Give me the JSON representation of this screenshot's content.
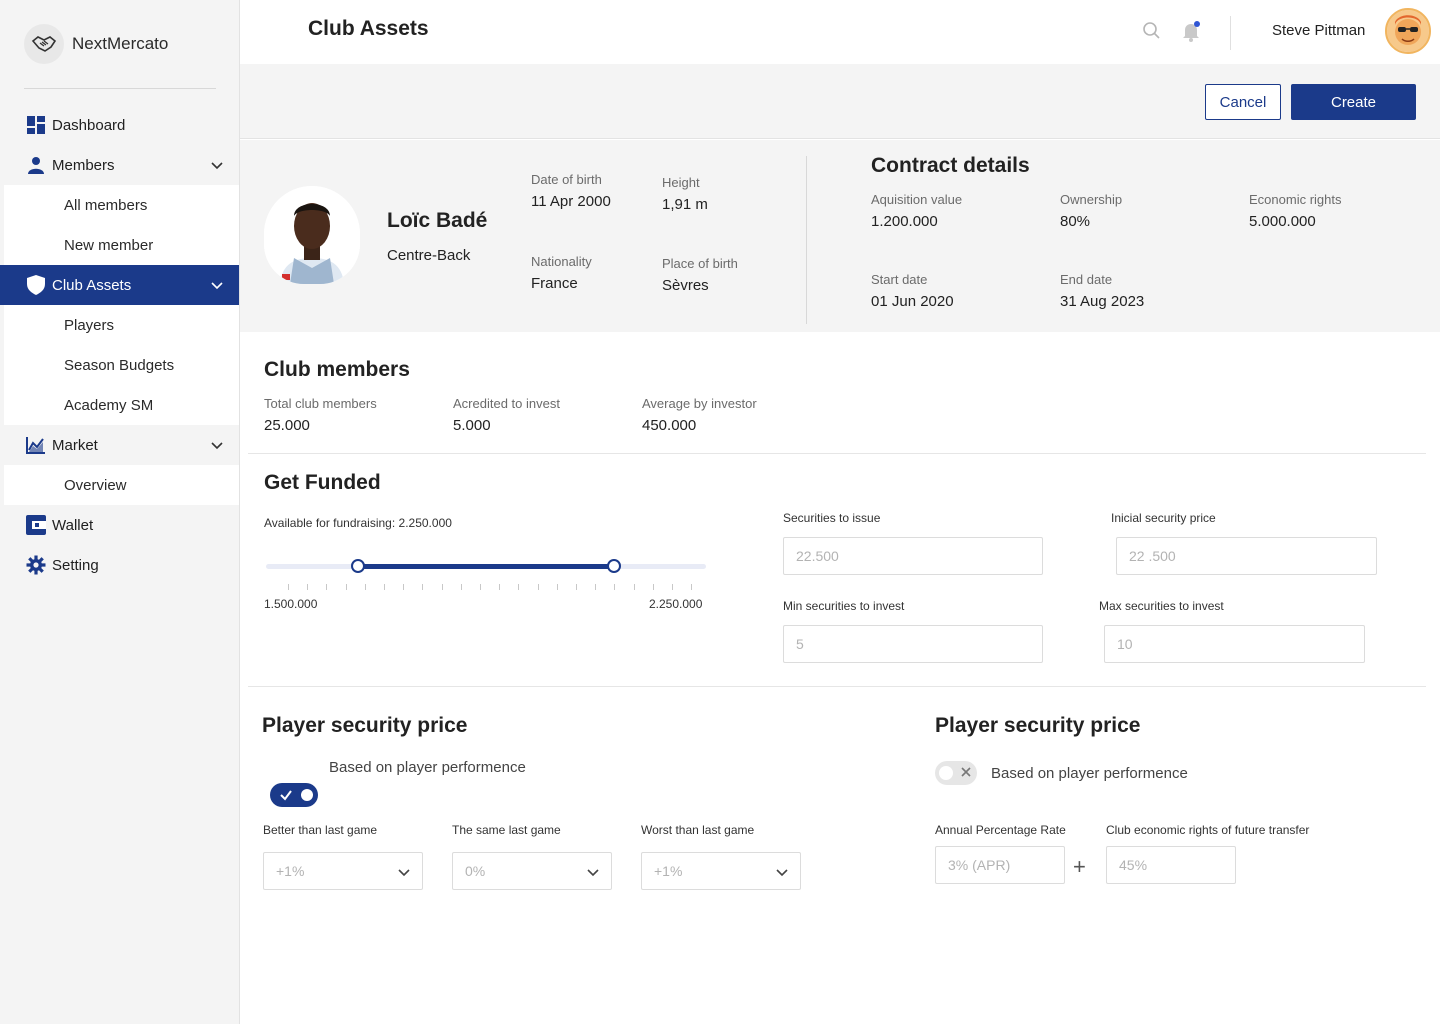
{
  "brand": {
    "name": "NextMercato"
  },
  "sidebar": {
    "dashboard": "Dashboard",
    "members": "Members",
    "all_members": "All members",
    "new_member": "New member",
    "club_assets": "Club Assets",
    "players": "Players",
    "season_budgets": "Season Budgets",
    "academy_sm": "Academy SM",
    "market": "Market",
    "overview": "Overview",
    "wallet": "Wallet",
    "setting": "Setting"
  },
  "header": {
    "title": "Club Assets",
    "user_name": "Steve Pittman"
  },
  "actions": {
    "cancel": "Cancel",
    "create": "Create"
  },
  "player": {
    "name": "Loïc Badé",
    "position": "Centre-Back",
    "dob_label": "Date of birth",
    "dob": "11 Apr 2000",
    "height_label": "Height",
    "height": "1,91 m",
    "nationality_label": "Nationality",
    "nationality": "France",
    "pob_label": "Place of birth",
    "pob": "Sèvres"
  },
  "contract": {
    "title": "Contract details",
    "acq_label": "Aquisition value",
    "acq": "1.200.000",
    "own_label": "Ownership",
    "own": "80%",
    "econ_label": "Economic rights",
    "econ": "5.000.000",
    "start_label": "Start date",
    "start": "01 Jun 2020",
    "end_label": "End date",
    "end": "31 Aug 2023"
  },
  "club_members": {
    "title": "Club members",
    "total_label": "Total club members",
    "total": "25.000",
    "accredited_label": "Acredited to invest",
    "accredited": "5.000",
    "avg_label": "Average by investor",
    "avg": "450.000"
  },
  "funded": {
    "title": "Get Funded",
    "available": "Available for fundraising: 2.250.000",
    "min_label": "1.500.000",
    "max_label": "2.250.000",
    "slider_low_fraction": 0.21,
    "slider_high_fraction": 0.79,
    "securities_label": "Securities to issue",
    "securities_placeholder": "22.500",
    "price_label": "Inicial security price",
    "price_placeholder": "22 .500",
    "min_invest_label": "Min securities to invest",
    "min_invest_placeholder": "5",
    "max_invest_label": "Max securities to invest",
    "max_invest_placeholder": "10"
  },
  "security_left": {
    "title": "Player security price",
    "toggle_label": "Based on player performence",
    "toggle_on": true,
    "better_label": "Better than last game",
    "better_value": "+1%",
    "same_label": "The same last game",
    "same_value": "0%",
    "worse_label": "Worst than last game",
    "worse_value": "+1%"
  },
  "security_right": {
    "title": "Player security price",
    "toggle_label": "Based on player performence",
    "toggle_on": false,
    "apr_label": "Annual Percentage Rate",
    "apr_placeholder": "3% (APR)",
    "rights_label": "Club economic rights of future transfer",
    "rights_placeholder": "45%"
  },
  "colors": {
    "accent": "#1b3a8a",
    "panel": "#f4f4f4",
    "notification": "#2f55d4"
  }
}
